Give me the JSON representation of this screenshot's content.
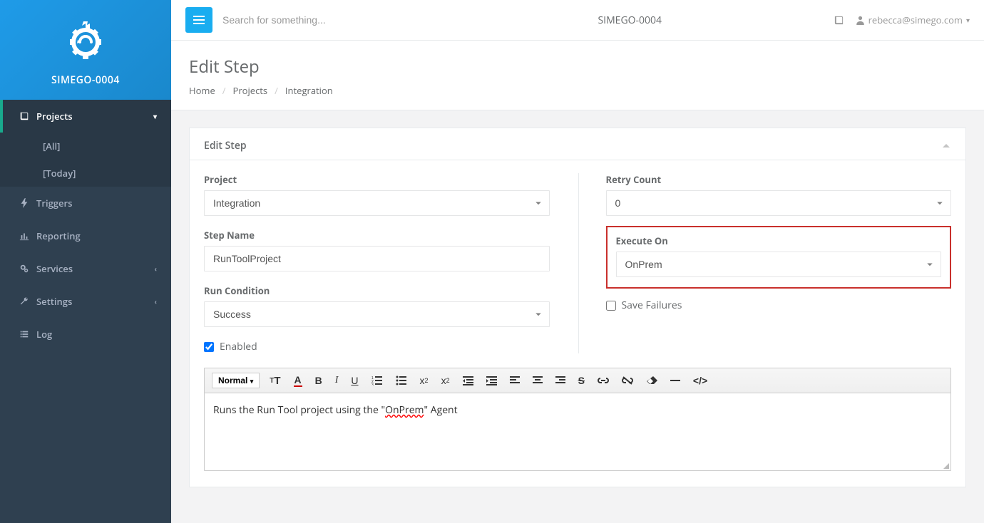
{
  "brand": "SIMEGO-0004",
  "sidebar": {
    "projects": {
      "label": "Projects",
      "sub": {
        "all": "[All]",
        "today": "[Today]"
      }
    },
    "triggers": "Triggers",
    "reporting": "Reporting",
    "services": "Services",
    "settings": "Settings",
    "log": "Log"
  },
  "topbar": {
    "search_placeholder": "Search for something...",
    "title": "SIMEGO-0004",
    "user": "rebecca@simego.com"
  },
  "page": {
    "title": "Edit Step",
    "breadcrumb": {
      "home": "Home",
      "projects": "Projects",
      "current": "Integration"
    }
  },
  "panel": {
    "title": "Edit Step"
  },
  "form": {
    "project": {
      "label": "Project",
      "value": "Integration"
    },
    "step_name": {
      "label": "Step Name",
      "value": "RunToolProject"
    },
    "run_condition": {
      "label": "Run Condition",
      "value": "Success"
    },
    "enabled": {
      "label": "Enabled",
      "checked": true
    },
    "retry_count": {
      "label": "Retry Count",
      "value": "0"
    },
    "execute_on": {
      "label": "Execute On",
      "value": "OnPrem"
    },
    "save_failures": {
      "label": "Save Failures",
      "checked": false
    }
  },
  "editor": {
    "mode": "Normal",
    "content_prefix": "Runs the Run Tool project using the \"",
    "content_spell": "OnPrem",
    "content_suffix": "\" Agent"
  }
}
